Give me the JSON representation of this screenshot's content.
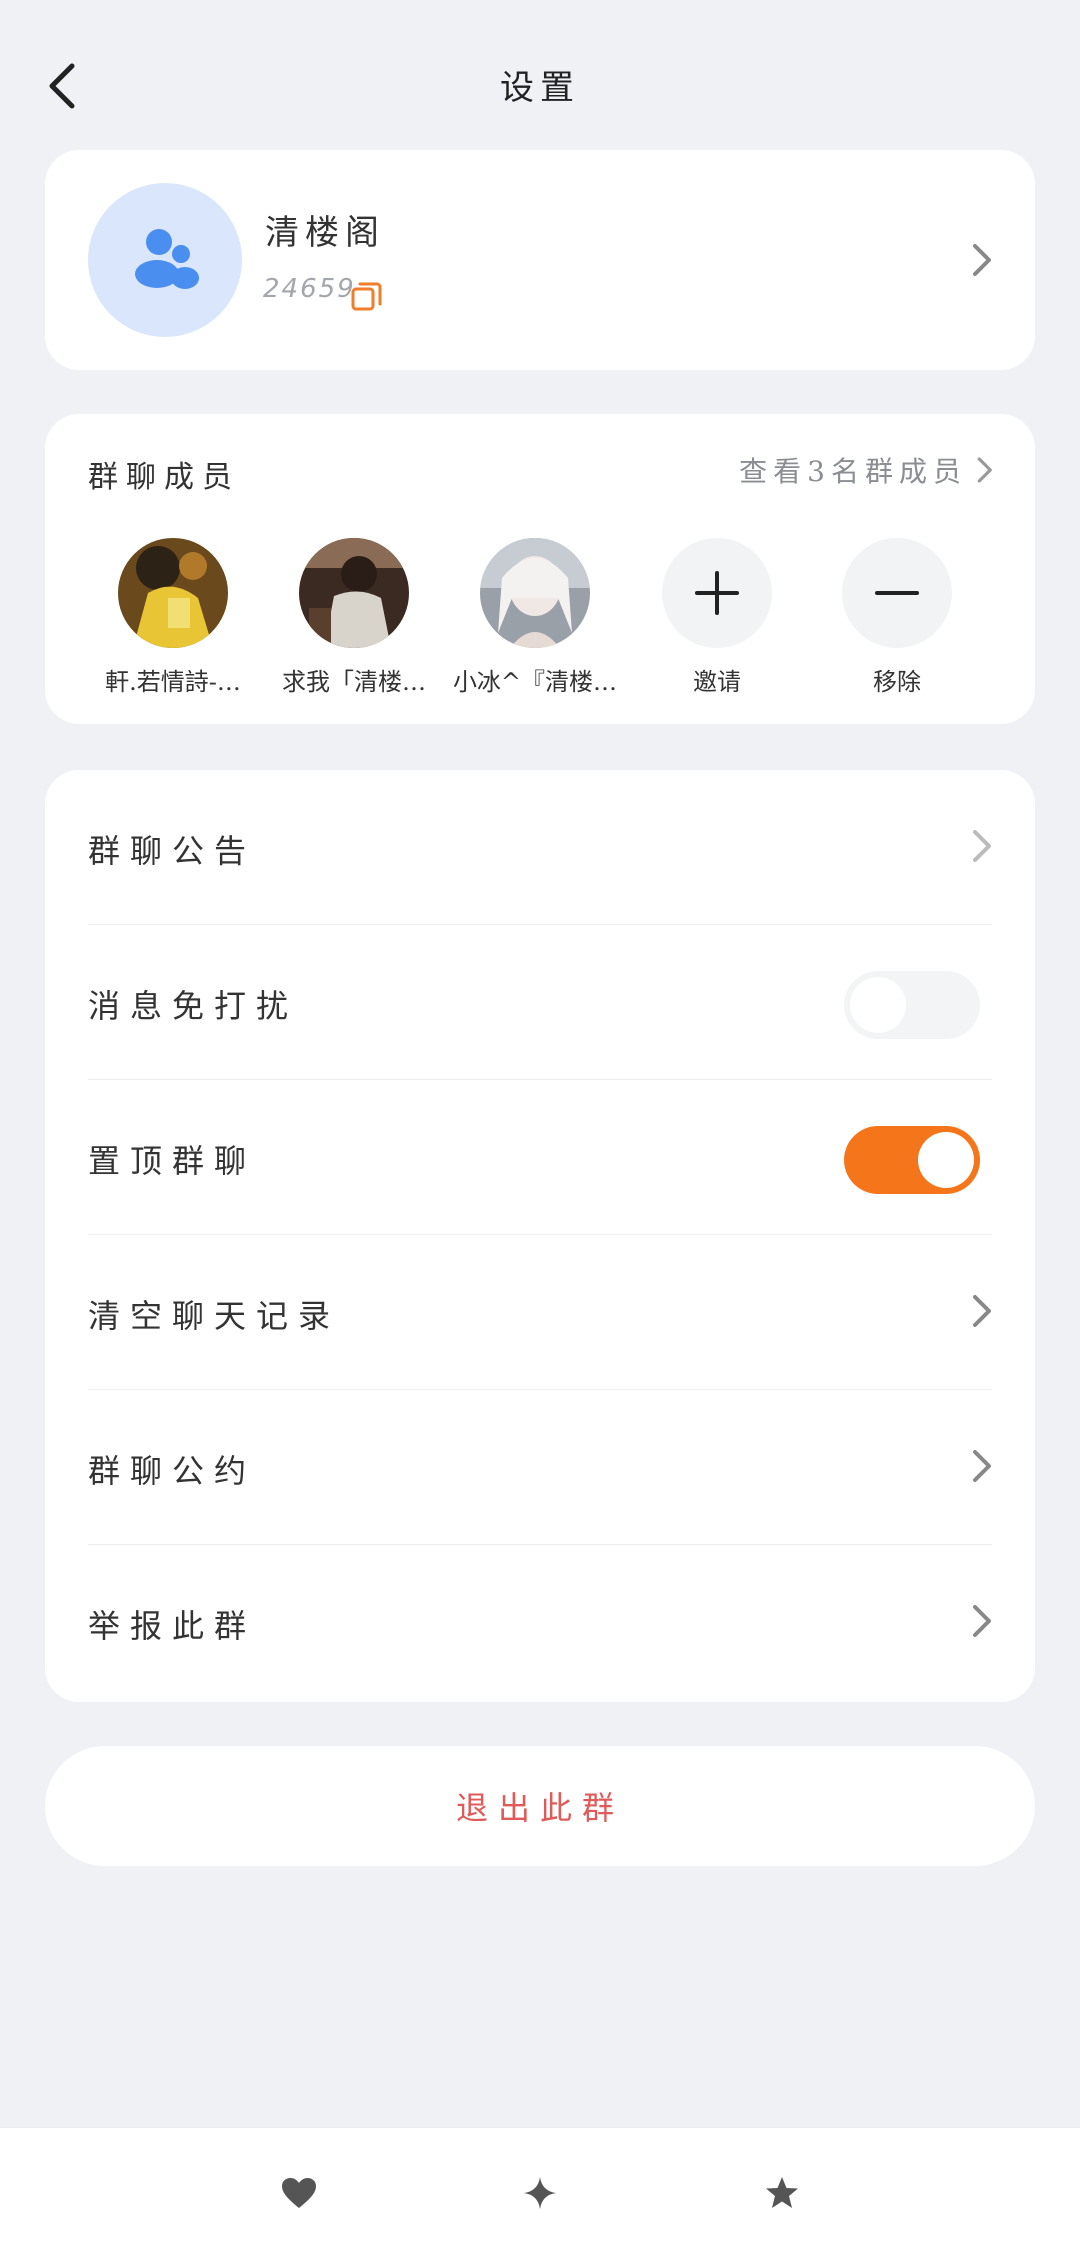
{
  "header": {
    "title": "设置"
  },
  "group": {
    "name": "清楼阁",
    "id": "24659"
  },
  "members": {
    "title": "群聊成员",
    "view_all_label": "查看3名群成员",
    "list": [
      {
        "name": "軒.若情詩-…"
      },
      {
        "name": "求我「清楼…"
      },
      {
        "name": "小冰^『清楼…"
      }
    ],
    "invite_label": "邀请",
    "remove_label": "移除"
  },
  "settings": {
    "items": [
      {
        "label": "群聊公告"
      },
      {
        "label": "消息免打扰",
        "toggle": "off"
      },
      {
        "label": "置顶群聊",
        "toggle": "on"
      },
      {
        "label": "清空聊天记录"
      },
      {
        "label": "群聊公约"
      },
      {
        "label": "举报此群"
      }
    ]
  },
  "exit_label": "退出此群",
  "colors": {
    "accent": "#f5761a",
    "danger": "#e05a5a",
    "group_avatar_bg": "#d9e6fb",
    "group_icon": "#4a8ef0"
  },
  "bottom_nav": {
    "icons": [
      "heart-icon",
      "sparkle-icon",
      "star-icon"
    ]
  }
}
